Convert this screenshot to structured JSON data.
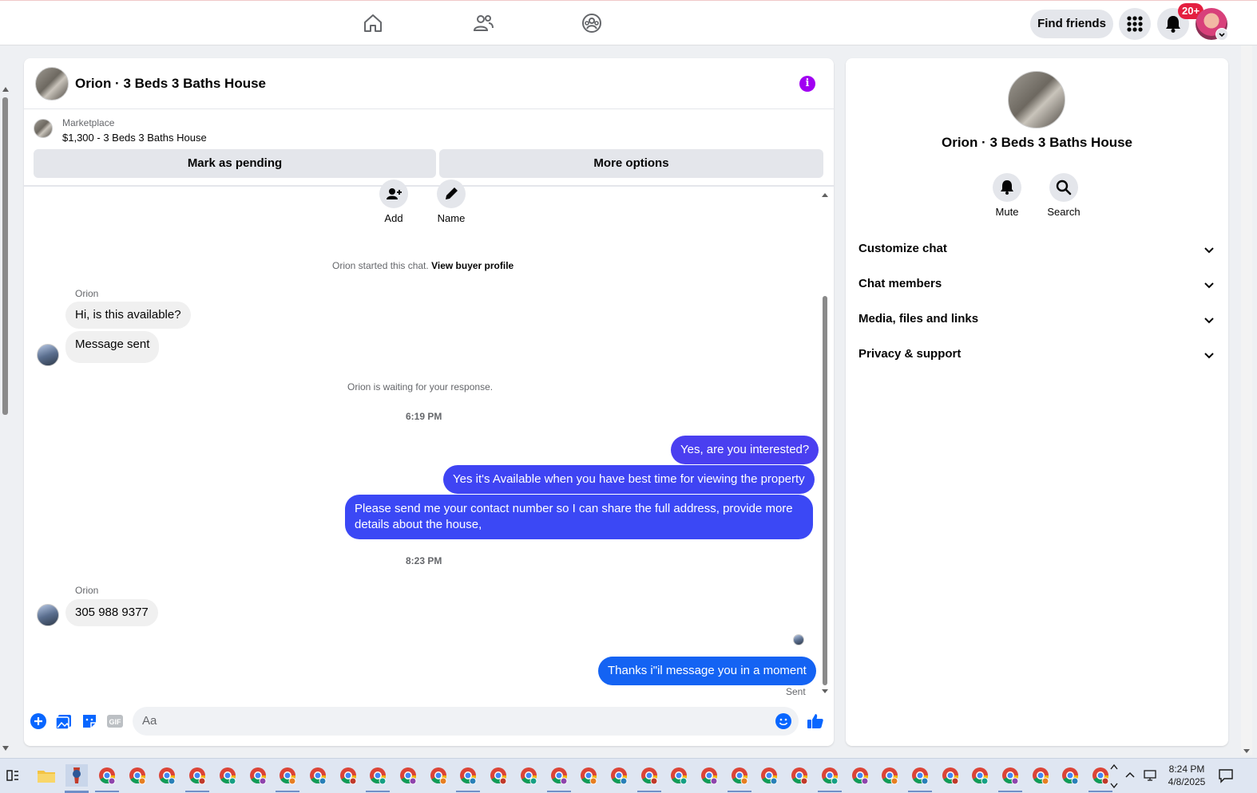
{
  "topbar": {
    "nav_icons": [
      "home-icon",
      "friends-icon",
      "groups-icon"
    ],
    "find_friends_label": "Find friends",
    "notification_count": "20+"
  },
  "chat": {
    "title": "Orion · 3 Beds 3 Baths House",
    "marketplace_label": "Marketplace",
    "listing_text": "$1,300 - 3 Beds 3 Baths House",
    "mark_pending_label": "Mark as pending",
    "more_options_label": "More options",
    "actions": [
      {
        "label": "Add",
        "icon": "add-person-icon"
      },
      {
        "label": "Name",
        "icon": "pencil-icon"
      }
    ],
    "started_text": "Orion started this chat.",
    "view_profile_link": "View buyer profile",
    "waiting_text": "Orion is waiting for your response.",
    "time1": "6:19 PM",
    "time2": "8:23 PM",
    "sender_name": "Orion",
    "messages_in_1": [
      "Hi, is this available?",
      "Message sent"
    ],
    "messages_out": [
      "Yes, are you interested?",
      "Yes it's Available when you have best time for viewing the property",
      "Please send me your contact number so I can share the full address, provide more details about the house,"
    ],
    "message_in_2": "305 988 9377",
    "last_message": "Thanks i\"il message you in a moment",
    "sent_label": "Sent",
    "composer_placeholder": "Aa",
    "composer_icons": [
      "plus-circle-icon",
      "photo-icon",
      "sticker-icon",
      "gif-icon",
      "emoji-icon",
      "thumbs-up-icon"
    ]
  },
  "info_panel": {
    "title": "Orion · 3 Beds 3 Baths House",
    "mute_label": "Mute",
    "search_label": "Search",
    "sections": [
      "Customize chat",
      "Chat members",
      "Media, files and links",
      "Privacy & support"
    ]
  },
  "taskbar": {
    "time": "8:24 PM",
    "date": "4/8/2025"
  },
  "colors": {
    "accent_purple": "#a100f2",
    "outgoing_bubble": "#4a3ff0",
    "outgoing_bubble_last": "#1463f3",
    "messenger_blue": "#0866ff"
  }
}
